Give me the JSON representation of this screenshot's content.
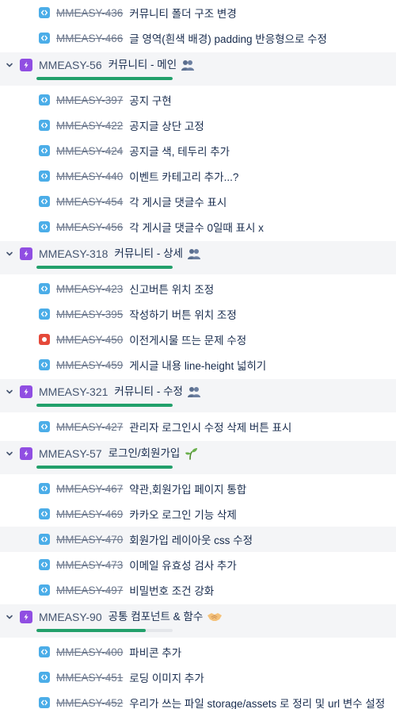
{
  "rows": [
    {
      "kind": "task",
      "key": "MMEASY-436",
      "summary": "커뮤니티 폴더 구조 변경",
      "icon": "subtask-icon"
    },
    {
      "kind": "task",
      "key": "MMEASY-466",
      "summary": "글 영역(흰색 배경) padding 반응형으로 수정",
      "icon": "subtask-icon"
    },
    {
      "kind": "epic",
      "key": "MMEASY-56",
      "summary": "커뮤니티 - 메인",
      "emoji": "people-emoji",
      "progress": 1.0
    },
    {
      "kind": "task",
      "key": "MMEASY-397",
      "summary": "공지 구현",
      "icon": "subtask-icon"
    },
    {
      "kind": "task",
      "key": "MMEASY-422",
      "summary": "공지글 상단 고정",
      "icon": "subtask-icon"
    },
    {
      "kind": "task",
      "key": "MMEASY-424",
      "summary": "공지글 색, 테두리 추가",
      "icon": "subtask-icon"
    },
    {
      "kind": "task",
      "key": "MMEASY-440",
      "summary": "이벤트 카테고리 추가...?",
      "icon": "subtask-icon"
    },
    {
      "kind": "task",
      "key": "MMEASY-454",
      "summary": "각 게시글 댓글수 표시",
      "icon": "subtask-icon"
    },
    {
      "kind": "task",
      "key": "MMEASY-456",
      "summary": "각 게시글 댓글수 0일때 표시 x",
      "icon": "subtask-icon"
    },
    {
      "kind": "epic",
      "key": "MMEASY-318",
      "summary": "커뮤니티 - 상세",
      "emoji": "people-emoji",
      "progress": 1.0
    },
    {
      "kind": "task",
      "key": "MMEASY-423",
      "summary": "신고버튼 위치 조정",
      "icon": "subtask-icon"
    },
    {
      "kind": "task",
      "key": "MMEASY-395",
      "summary": "작성하기 버튼 위치 조정",
      "icon": "subtask-icon"
    },
    {
      "kind": "task",
      "key": "MMEASY-450",
      "summary": "이전게시물 뜨는 문제 수정",
      "icon": "bug-icon"
    },
    {
      "kind": "task",
      "key": "MMEASY-459",
      "summary": "게시글 내용 line-height 넓히기",
      "icon": "subtask-icon"
    },
    {
      "kind": "epic",
      "key": "MMEASY-321",
      "summary": "커뮤니티 - 수정",
      "emoji": "people-emoji",
      "progress": 1.0
    },
    {
      "kind": "task",
      "key": "MMEASY-427",
      "summary": "관리자 로그인시 수정 삭제 버튼 표시",
      "icon": "subtask-icon"
    },
    {
      "kind": "epic",
      "key": "MMEASY-57",
      "summary": "로그인/회원가입",
      "emoji": "seedling-emoji",
      "progress": 1.0
    },
    {
      "kind": "task",
      "key": "MMEASY-467",
      "summary": "약관,회원가입 페이지 통합",
      "icon": "subtask-icon"
    },
    {
      "kind": "task",
      "key": "MMEASY-469",
      "summary": "카카오 로그인 기능 삭제",
      "icon": "subtask-icon"
    },
    {
      "kind": "task",
      "key": "MMEASY-470",
      "summary": "회원가입 레이아웃 css 수정",
      "icon": "subtask-icon",
      "highlighted": true
    },
    {
      "kind": "task",
      "key": "MMEASY-473",
      "summary": "이메일 유효성 검사 추가",
      "icon": "subtask-icon"
    },
    {
      "kind": "task",
      "key": "MMEASY-497",
      "summary": "비밀번호 조건 강화",
      "icon": "subtask-icon"
    },
    {
      "kind": "epic",
      "key": "MMEASY-90",
      "summary": "공통 컴포넌트 & 함수",
      "emoji": "handshake-emoji",
      "progress": 0.8
    },
    {
      "kind": "task",
      "key": "MMEASY-400",
      "summary": "파비콘 추가",
      "icon": "subtask-icon"
    },
    {
      "kind": "task",
      "key": "MMEASY-451",
      "summary": "로딩 이미지 추가",
      "icon": "subtask-icon"
    },
    {
      "kind": "task",
      "key": "MMEASY-452",
      "summary": "우리가 쓰는 파일 storage/assets 로 정리 및 url 변수 설정",
      "icon": "subtask-icon"
    }
  ],
  "colors": {
    "epic": "#904ee2",
    "subtask": "#4bade8",
    "bug": "#e5493a",
    "progress_done": "#22a06b",
    "progress_track": "#e4e6ea"
  }
}
